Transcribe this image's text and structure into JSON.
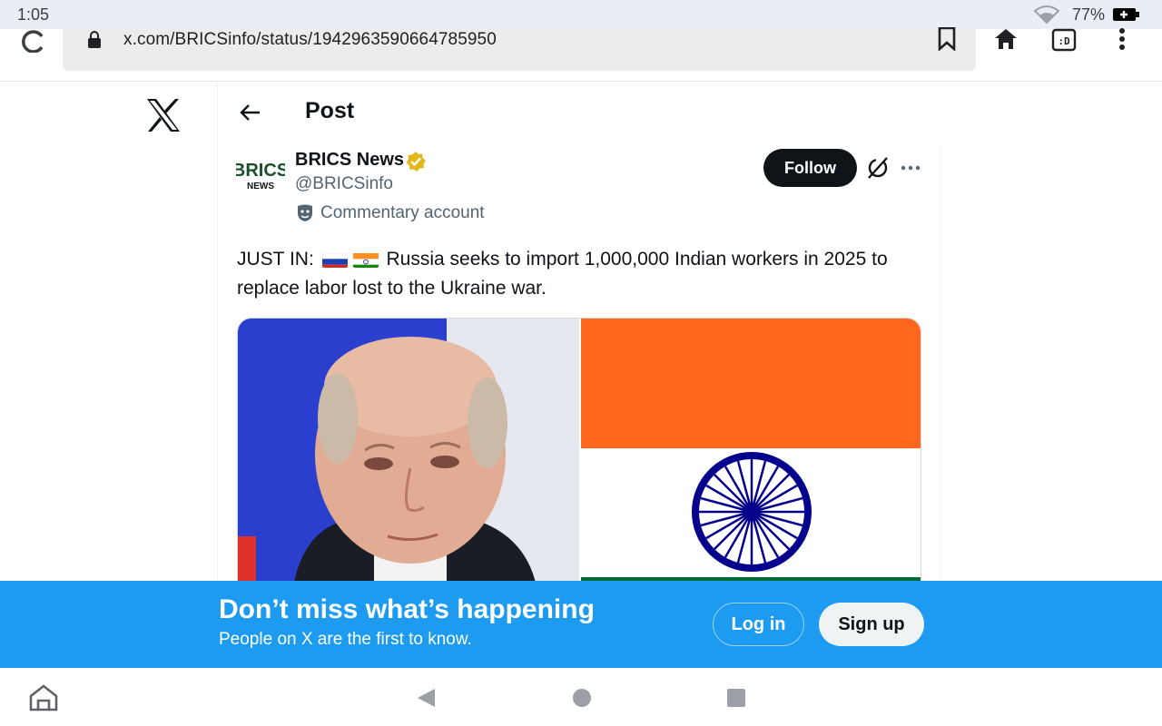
{
  "status_bar": {
    "time": "1:05",
    "battery_percent": "77%"
  },
  "browser": {
    "url": "x.com/BRICSinfo/status/1942963590664785950",
    "icons": [
      "reload-icon",
      "lock-icon",
      "bookmark-icon",
      "home-icon",
      "extension-icon",
      "menu-icon"
    ]
  },
  "header": {
    "title": "Post"
  },
  "author": {
    "avatar_text_top": "BRICS",
    "avatar_text_bottom": "NEWS",
    "name": "BRICS News",
    "handle": "@BRICSinfo",
    "label": "Commentary account",
    "follow_label": "Follow"
  },
  "tweet": {
    "prefix": "JUST IN:",
    "body": "Russia seeks to import 1,000,000 Indian workers in 2025 to replace labor lost to the Ukraine war."
  },
  "banner": {
    "title": "Don’t miss what’s happening",
    "subtitle": "People on X are the first to know.",
    "login_label": "Log in",
    "signup_label": "Sign up"
  },
  "colors": {
    "accent": "#1d9bf0",
    "text": "#0f1419",
    "secondary_text": "#536471",
    "verified_gold": "#e2b719",
    "saffron": "#ff671f",
    "india_green": "#046a38",
    "chakra_blue": "#06038d"
  }
}
